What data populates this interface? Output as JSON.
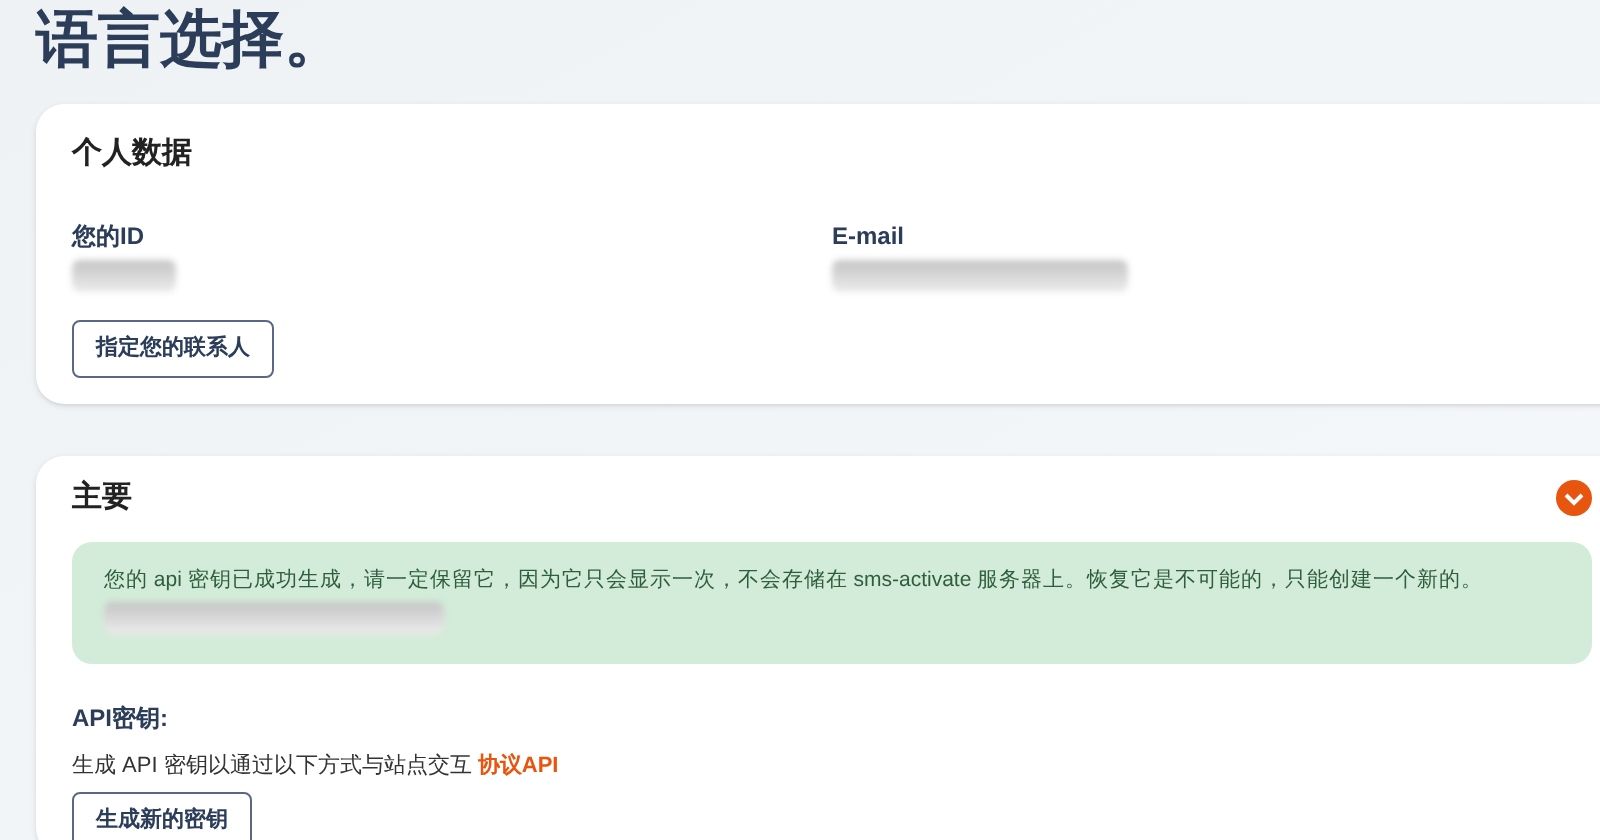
{
  "page_title": "语言选择。",
  "personal": {
    "title": "个人数据",
    "fields": [
      {
        "label": "您的ID"
      },
      {
        "label": "E-mail"
      }
    ],
    "button": "指定您的联系人"
  },
  "main": {
    "title": "主要",
    "expanded": true,
    "alert": "您的 api 密钥已成功生成，请一定保留它，因为它只会显示一次，不会存储在 sms-activate 服务器上。恢复它是不可能的，只能创建一个新的。",
    "api_label": "API密钥:",
    "api_text": "生成 API 密钥以通过以下方式与站点交互",
    "api_link": "协议API",
    "button": "生成新的密钥"
  }
}
